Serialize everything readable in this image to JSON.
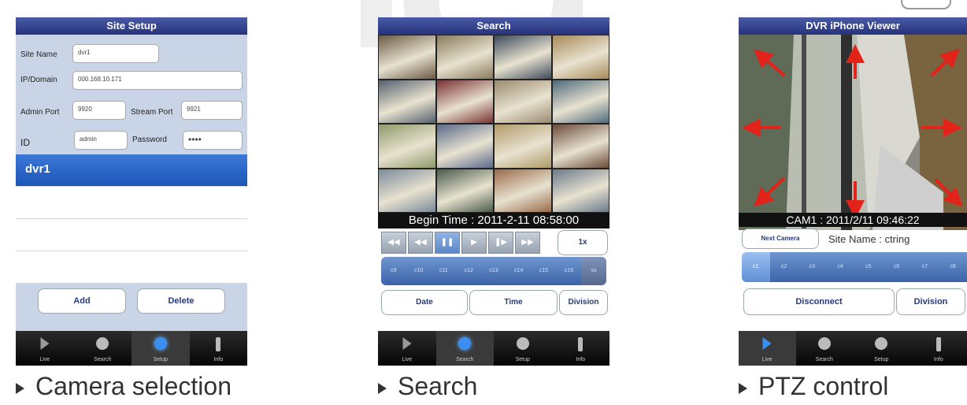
{
  "panels": {
    "setup": {
      "title": "Site Setup",
      "labels": {
        "site_name": "Site Name",
        "ip_domain": "IP/Domain",
        "admin_port": "Admin Port",
        "stream_port": "Stream Port",
        "id": "ID",
        "password": "Password"
      },
      "values": {
        "site_name": "dvr1",
        "ip_domain": "000.168.10.171",
        "admin_port": "9920",
        "stream_port": "9921",
        "id": "admin",
        "password": "••••"
      },
      "list": [
        "dvr1",
        "",
        "",
        ""
      ],
      "buttons": {
        "add": "Add",
        "delete": "Delete"
      }
    },
    "search": {
      "title": "Search",
      "time": "Begin Time : 2011-2-11 08:58:00",
      "speed": "1x",
      "channels": [
        "c9",
        "c10",
        "c11",
        "c12",
        "c13",
        "c14",
        "c15",
        "c16",
        "ss"
      ],
      "buttons": {
        "date": "Date",
        "time": "Time",
        "division": "Division"
      }
    },
    "ptz": {
      "title": "DVR iPhone Viewer",
      "time": "CAM1 : 2011/2/11 09:46:22",
      "next_camera": "Next Camera",
      "site_name": "Site Name : ctring",
      "channels": [
        "c1",
        "c2",
        "c3",
        "c4",
        "c5",
        "c6",
        "c7",
        "c8"
      ],
      "buttons": {
        "disconnect": "Disconnect",
        "division": "Division"
      }
    }
  },
  "tabs": {
    "live": "Live",
    "search": "Search",
    "setup": "Setup",
    "info": "Info"
  },
  "captions": {
    "camera": "Camera selection",
    "search": "Search",
    "ptz": "PTZ control"
  },
  "colors": {
    "accent": "#1d56b8",
    "titlebar": "#27337a",
    "ptz_arrow": "#e2231a"
  }
}
